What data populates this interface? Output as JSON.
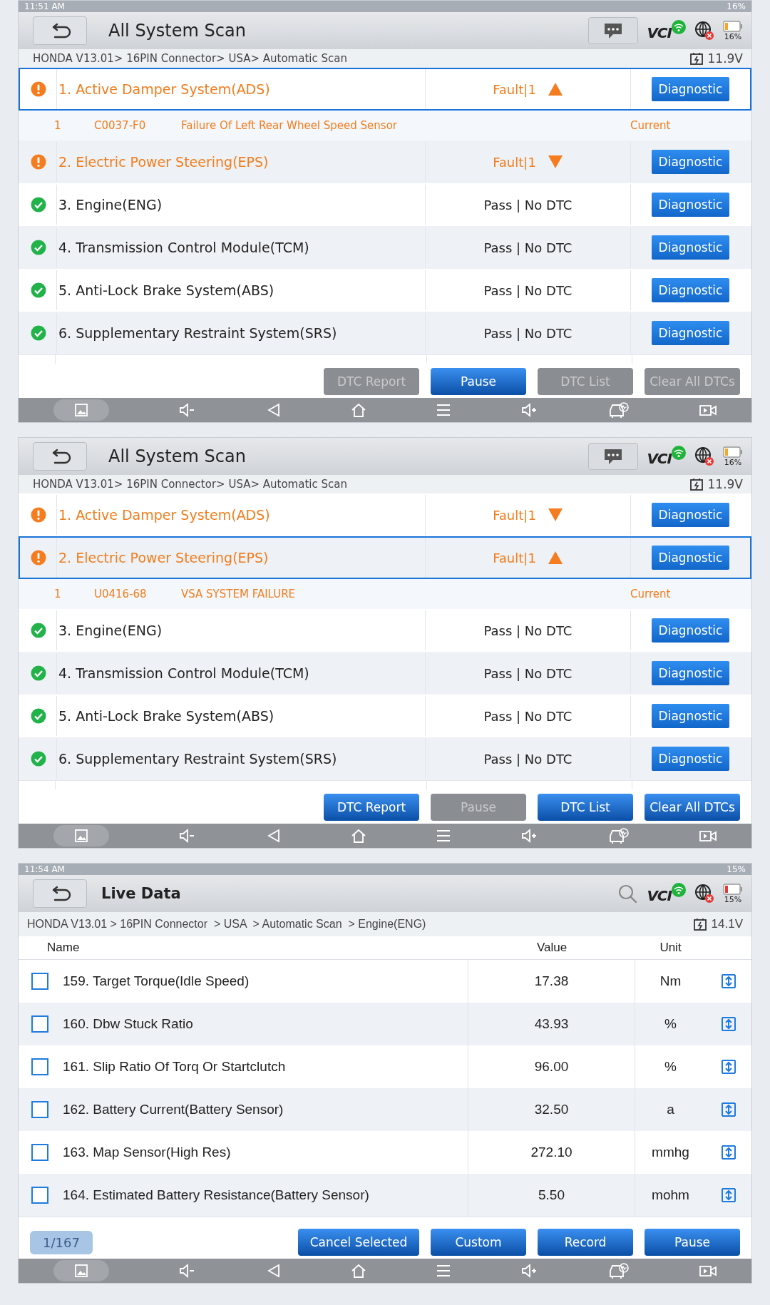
{
  "panels": [
    {
      "kind": "scan",
      "status_bar": {
        "time": "11:51 AM",
        "battery": "16%"
      },
      "title": "All System Scan",
      "vci_label": "VCI",
      "breadcrumb": "HONDA V13.01> 16PIN Connector> USA> Automatic Scan",
      "voltage": "11.9V",
      "battery_percent": "16%",
      "systems": [
        {
          "kind": "fault",
          "name": "1. Active Damper System(ADS)",
          "result": "Fault|1",
          "expanded": true,
          "selected": true,
          "action": "Diagnostic",
          "dtcs": [
            {
              "index": "1",
              "code": "C0037-F0",
              "description": "Failure Of Left Rear Wheel Speed Sensor",
              "state": "Current"
            }
          ]
        },
        {
          "kind": "fault",
          "name": "2. Electric Power Steering(EPS)",
          "result": "Fault|1",
          "expanded": false,
          "selected": false,
          "action": "Diagnostic"
        },
        {
          "kind": "pass",
          "name": "3. Engine(ENG)",
          "result": "Pass | No DTC",
          "selected": false,
          "action": "Diagnostic"
        },
        {
          "kind": "pass",
          "name": "4. Transmission Control Module(TCM)",
          "result": "Pass | No DTC",
          "selected": false,
          "action": "Diagnostic"
        },
        {
          "kind": "pass",
          "name": "5. Anti-Lock Brake System(ABS)",
          "result": "Pass | No DTC",
          "selected": false,
          "action": "Diagnostic"
        },
        {
          "kind": "pass",
          "name": "6. Supplementary Restraint System(SRS)",
          "result": "Pass | No DTC",
          "selected": false,
          "action": "Diagnostic"
        }
      ],
      "buttons": [
        {
          "label": "DTC Report",
          "disabled": true
        },
        {
          "label": "Pause",
          "disabled": false
        },
        {
          "label": "DTC List",
          "disabled": true
        },
        {
          "label": "Clear All DTCs",
          "disabled": true
        }
      ]
    },
    {
      "kind": "scan",
      "title": "All System Scan",
      "vci_label": "VCI",
      "breadcrumb": "HONDA V13.01> 16PIN Connector> USA> Automatic Scan",
      "voltage": "11.9V",
      "battery_percent": "16%",
      "systems": [
        {
          "kind": "fault",
          "name": "1. Active Damper System(ADS)",
          "result": "Fault|1",
          "expanded": false,
          "selected": false,
          "action": "Diagnostic"
        },
        {
          "kind": "fault",
          "name": "2. Electric Power Steering(EPS)",
          "result": "Fault|1",
          "expanded": true,
          "selected": true,
          "action": "Diagnostic",
          "dtcs": [
            {
              "index": "1",
              "code": "U0416-68",
              "description": "VSA SYSTEM FAILURE",
              "state": "Current"
            }
          ]
        },
        {
          "kind": "pass",
          "name": "3. Engine(ENG)",
          "result": "Pass | No DTC",
          "selected": false,
          "action": "Diagnostic"
        },
        {
          "kind": "pass",
          "name": "4. Transmission Control Module(TCM)",
          "result": "Pass | No DTC",
          "selected": false,
          "action": "Diagnostic"
        },
        {
          "kind": "pass",
          "name": "5. Anti-Lock Brake System(ABS)",
          "result": "Pass | No DTC",
          "selected": false,
          "action": "Diagnostic"
        },
        {
          "kind": "pass",
          "name": "6. Supplementary Restraint System(SRS)",
          "result": "Pass | No DTC",
          "selected": false,
          "action": "Diagnostic"
        }
      ],
      "buttons": [
        {
          "label": "DTC Report",
          "disabled": false
        },
        {
          "label": "Pause",
          "disabled": true
        },
        {
          "label": "DTC List",
          "disabled": false
        },
        {
          "label": "Clear All DTCs",
          "disabled": false
        }
      ]
    },
    {
      "kind": "live",
      "status_bar": {
        "time": "11:54 AM",
        "battery": "15%"
      },
      "title": "Live Data",
      "vci_label": "VCI",
      "breadcrumb": "HONDA V13.01 > 16PIN Connector  > USA  > Automatic Scan  > Engine(ENG)",
      "voltage": "14.1V",
      "battery_percent": "15%",
      "columns": [
        "Name",
        "Value",
        "Unit"
      ],
      "rows": [
        {
          "checked": false,
          "name": "159. Target Torque(Idle Speed)",
          "value": "17.38",
          "unit": "Nm"
        },
        {
          "checked": false,
          "name": "160. Dbw Stuck Ratio",
          "value": "43.93",
          "unit": "%"
        },
        {
          "checked": false,
          "name": "161. Slip Ratio Of Torq Or Startclutch",
          "value": "96.00",
          "unit": "%"
        },
        {
          "checked": false,
          "name": "162. Battery Current(Battery Sensor)",
          "value": "32.50",
          "unit": "a"
        },
        {
          "checked": false,
          "name": "163. Map Sensor(High Res)",
          "value": "272.10",
          "unit": "mmhg"
        },
        {
          "checked": false,
          "name": "164. Estimated Battery Resistance(Battery Sensor)",
          "value": "5.50",
          "unit": "mohm"
        }
      ],
      "page": "1/167",
      "buttons": [
        {
          "label": "Cancel Selected",
          "disabled": false
        },
        {
          "label": "Custom",
          "disabled": false
        },
        {
          "label": "Record",
          "disabled": false
        },
        {
          "label": "Pause",
          "disabled": false
        }
      ]
    }
  ]
}
